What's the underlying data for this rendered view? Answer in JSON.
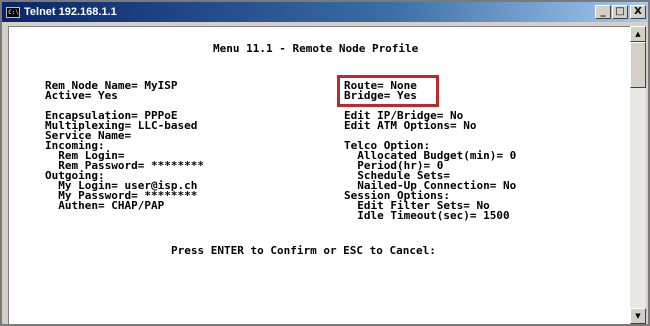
{
  "window": {
    "title": "Telnet 192.168.1.1",
    "icon_label": "C:\\",
    "controls": {
      "minimize": "_",
      "maximize": "□",
      "close": "X"
    }
  },
  "console": {
    "menu_title": "Menu 11.1 - Remote Node Profile",
    "left_column": [
      "Rem Node Name= MyISP",
      "Active= Yes",
      "",
      "Encapsulation= PPPoE",
      "Multiplexing= LLC-based",
      "Service Name=",
      "Incoming:",
      "  Rem Login=",
      "  Rem Password= ********",
      "Outgoing:",
      "  My Login= user@isp.ch",
      "  My Password= ********",
      "  Authen= CHAP/PAP"
    ],
    "right_column": [
      "Route= None",
      "Bridge= Yes",
      "",
      "Edit IP/Bridge= No",
      "Edit ATM Options= No",
      "",
      "Telco Option:",
      "  Allocated Budget(min)= 0",
      "  Period(hr)= 0",
      "  Schedule Sets=",
      "  Nailed-Up Connection= No",
      "Session Options:",
      "  Edit Filter Sets= No",
      "  Idle Timeout(sec)= 1500"
    ],
    "prompt": "Press ENTER to Confirm or ESC to Cancel:"
  },
  "scrollbar": {
    "up_glyph": "▲",
    "down_glyph": "▼"
  },
  "colors": {
    "highlight_border": "#c0282d",
    "titlebar_start": "#0a246a",
    "titlebar_end": "#a6caf0"
  }
}
